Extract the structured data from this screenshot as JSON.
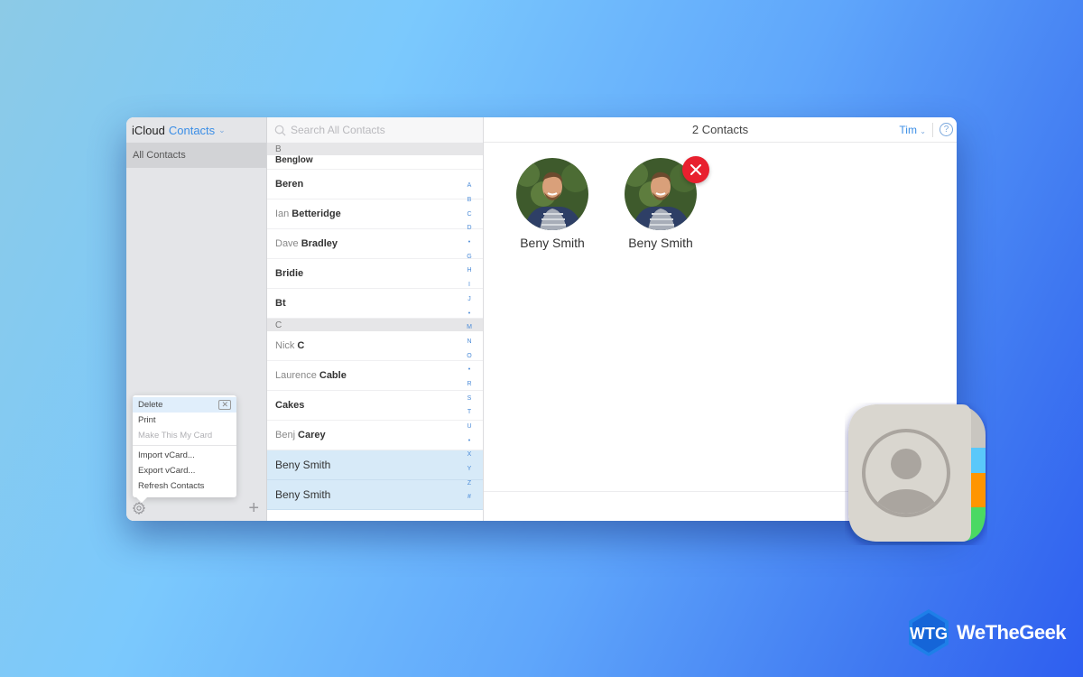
{
  "sidebar": {
    "brand": "iCloud",
    "app": "Contacts",
    "groups": [
      {
        "label": "All Contacts"
      }
    ],
    "menu": {
      "items": [
        {
          "label": "Delete",
          "shortcut_icon": "delete-key-icon",
          "state": "hover"
        },
        {
          "label": "Print",
          "state": "normal"
        },
        {
          "label": "Make This My Card",
          "state": "disabled"
        },
        {
          "label": "Import vCard...",
          "state": "normal"
        },
        {
          "label": "Export vCard...",
          "state": "normal"
        },
        {
          "label": "Refresh Contacts",
          "state": "normal"
        }
      ]
    },
    "footer": {
      "settings_icon": "gear-icon",
      "add_icon": "plus-icon"
    }
  },
  "list": {
    "search_placeholder": "Search All Contacts",
    "sections": [
      {
        "letter": "B",
        "contacts": [
          {
            "first": "",
            "last": "Benglow",
            "partial": true
          },
          {
            "first": "",
            "last": "Beren"
          },
          {
            "first": "Ian",
            "last": "Betteridge"
          },
          {
            "first": "Dave",
            "last": "Bradley"
          },
          {
            "first": "",
            "last": "Bridie"
          },
          {
            "first": "",
            "last": "Bt"
          }
        ]
      },
      {
        "letter": "C",
        "contacts": [
          {
            "first": "Nick",
            "last": "C"
          },
          {
            "first": "Laurence",
            "last": "Cable"
          },
          {
            "first": "",
            "last": "Cakes"
          },
          {
            "first": "Benj",
            "last": "Carey"
          }
        ]
      }
    ],
    "selected": [
      "Beny Smith",
      "Beny Smith"
    ],
    "index": [
      "A",
      "B",
      "C",
      "D",
      "•",
      "G",
      "H",
      "I",
      "J",
      "•",
      "M",
      "N",
      "O",
      "•",
      "R",
      "S",
      "T",
      "U",
      "•",
      "X",
      "Y",
      "Z",
      "#"
    ]
  },
  "detail": {
    "title": "2 Contacts",
    "user": "Tim",
    "help": "?",
    "cards": [
      {
        "name": "Beny Smith",
        "delete_badge": false
      },
      {
        "name": "Beny Smith",
        "delete_badge": true
      }
    ]
  },
  "overlay": {
    "app_icon": "contacts-app-icon",
    "tab_colors": [
      "#c9c6c0",
      "#5ac8fa",
      "#ff9500",
      "#4cd964"
    ]
  },
  "brand": {
    "logo_text": "WeTheGeek",
    "logo_mark": "WTG"
  }
}
